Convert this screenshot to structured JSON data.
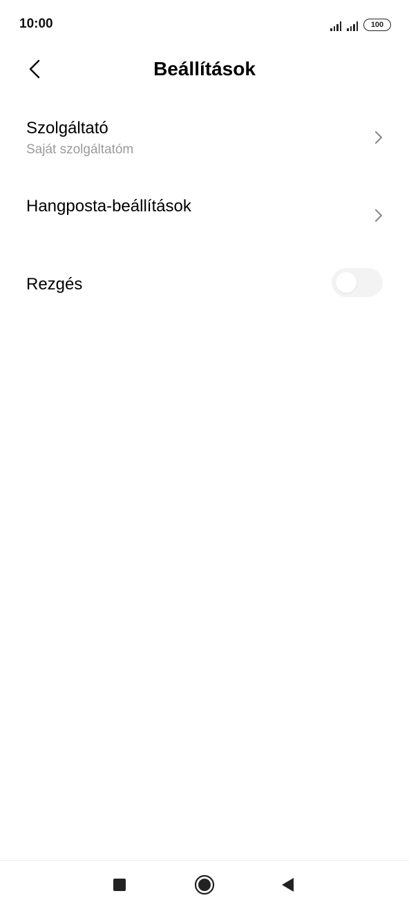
{
  "status_bar": {
    "time": "10:00",
    "battery": "100",
    "icons": [
      "signal-icon",
      "signal-icon",
      "battery-icon"
    ]
  },
  "header": {
    "title": "Beállítások",
    "back_icon": "chevron-left-icon"
  },
  "settings": {
    "items": [
      {
        "title": "Szolgáltató",
        "subtitle": "Saját szolgáltatóm",
        "icon": "chevron-right-icon"
      },
      {
        "title": "Hangposta-beállítások",
        "icon": "chevron-right-icon"
      },
      {
        "title": "Rezgés",
        "toggle_on": false
      }
    ]
  },
  "nav_bar": {
    "icons": [
      "recents-square-icon",
      "home-circle-icon",
      "back-triangle-icon"
    ]
  },
  "colors": {
    "subtitle": "#9a9a9a",
    "chevron": "#8a8a8a",
    "toggle_track_off": "#f3f3f3"
  }
}
